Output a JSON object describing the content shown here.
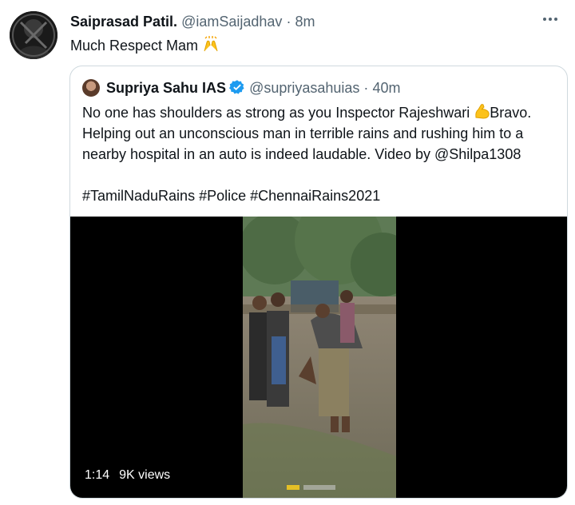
{
  "tweet": {
    "author_name": "Saiprasad Patil.",
    "author_handle": "@iamSaijadhav",
    "separator": "·",
    "time": "8m",
    "text": "Much Respect Mam"
  },
  "quoted_tweet": {
    "author_name": "Supriya Sahu IAS",
    "author_handle": "@supriyasahuias",
    "separator": "·",
    "time": "40m",
    "text_line_1a": "No one has shoulders as strong as you Inspector Rajeshwari",
    "text_line_1b": "Bravo.",
    "text_line_2": "Helping out an unconscious man in terrible rains and rushing him to a",
    "text_line_3": "nearby hospital in an auto is indeed laudable. Video by @Shilpa1308",
    "hashtags": "#TamilNaduRains #Police #ChennaiRains2021"
  },
  "video": {
    "duration": "1:14",
    "views": "9K views"
  },
  "icons": {
    "more": "more-options-icon",
    "verified": "verified-badge-icon",
    "raised_hands": "raised-hands-emoji",
    "flexed_biceps": "flexed-biceps-emoji"
  },
  "colors": {
    "text_primary": "#0f1419",
    "text_secondary": "#536471",
    "verified_blue": "#1d9bf0",
    "border": "#cfd9de",
    "video_bg": "#000000"
  }
}
